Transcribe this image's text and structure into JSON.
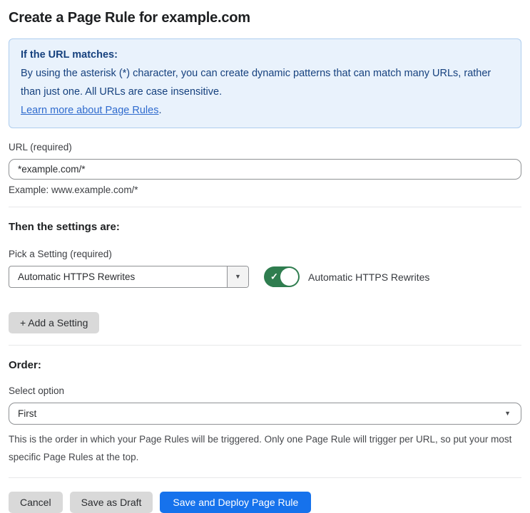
{
  "page": {
    "title": "Create a Page Rule for example.com"
  },
  "info_box": {
    "heading": "If the URL matches:",
    "body": "By using the asterisk (*) character, you can create dynamic patterns that can match many URLs, rather than just one. All URLs are case insensitive.",
    "link_text": "Learn more about Page Rules",
    "link_suffix": "."
  },
  "url_field": {
    "label": "URL (required)",
    "value": "*example.com/*",
    "helper": "Example: www.example.com/*"
  },
  "settings": {
    "heading": "Then the settings are:",
    "picker_label": "Pick a Setting (required)",
    "picker_value": "Automatic HTTPS Rewrites",
    "picker_caret": "▼",
    "toggle_state": "on",
    "toggle_check": "✓",
    "toggle_label": "Automatic HTTPS Rewrites",
    "add_button_label": "+ Add a Setting"
  },
  "order": {
    "heading": "Order:",
    "select_label": "Select option",
    "select_value": "First",
    "select_caret": "▼",
    "help": "This is the order in which your Page Rules will be triggered. Only one Page Rule will trigger per URL, so put your most specific Page Rules at the top."
  },
  "footer": {
    "cancel_label": "Cancel",
    "save_draft_label": "Save as Draft",
    "save_deploy_label": "Save and Deploy Page Rule"
  },
  "colors": {
    "info_bg": "#e9f2fc",
    "info_border": "#aecdee",
    "info_text": "#16417e",
    "link_blue": "#2f6bce",
    "toggle_green": "#2f7d4f",
    "primary_button_blue": "#1672ec",
    "gray_button": "#d9d9d9"
  }
}
